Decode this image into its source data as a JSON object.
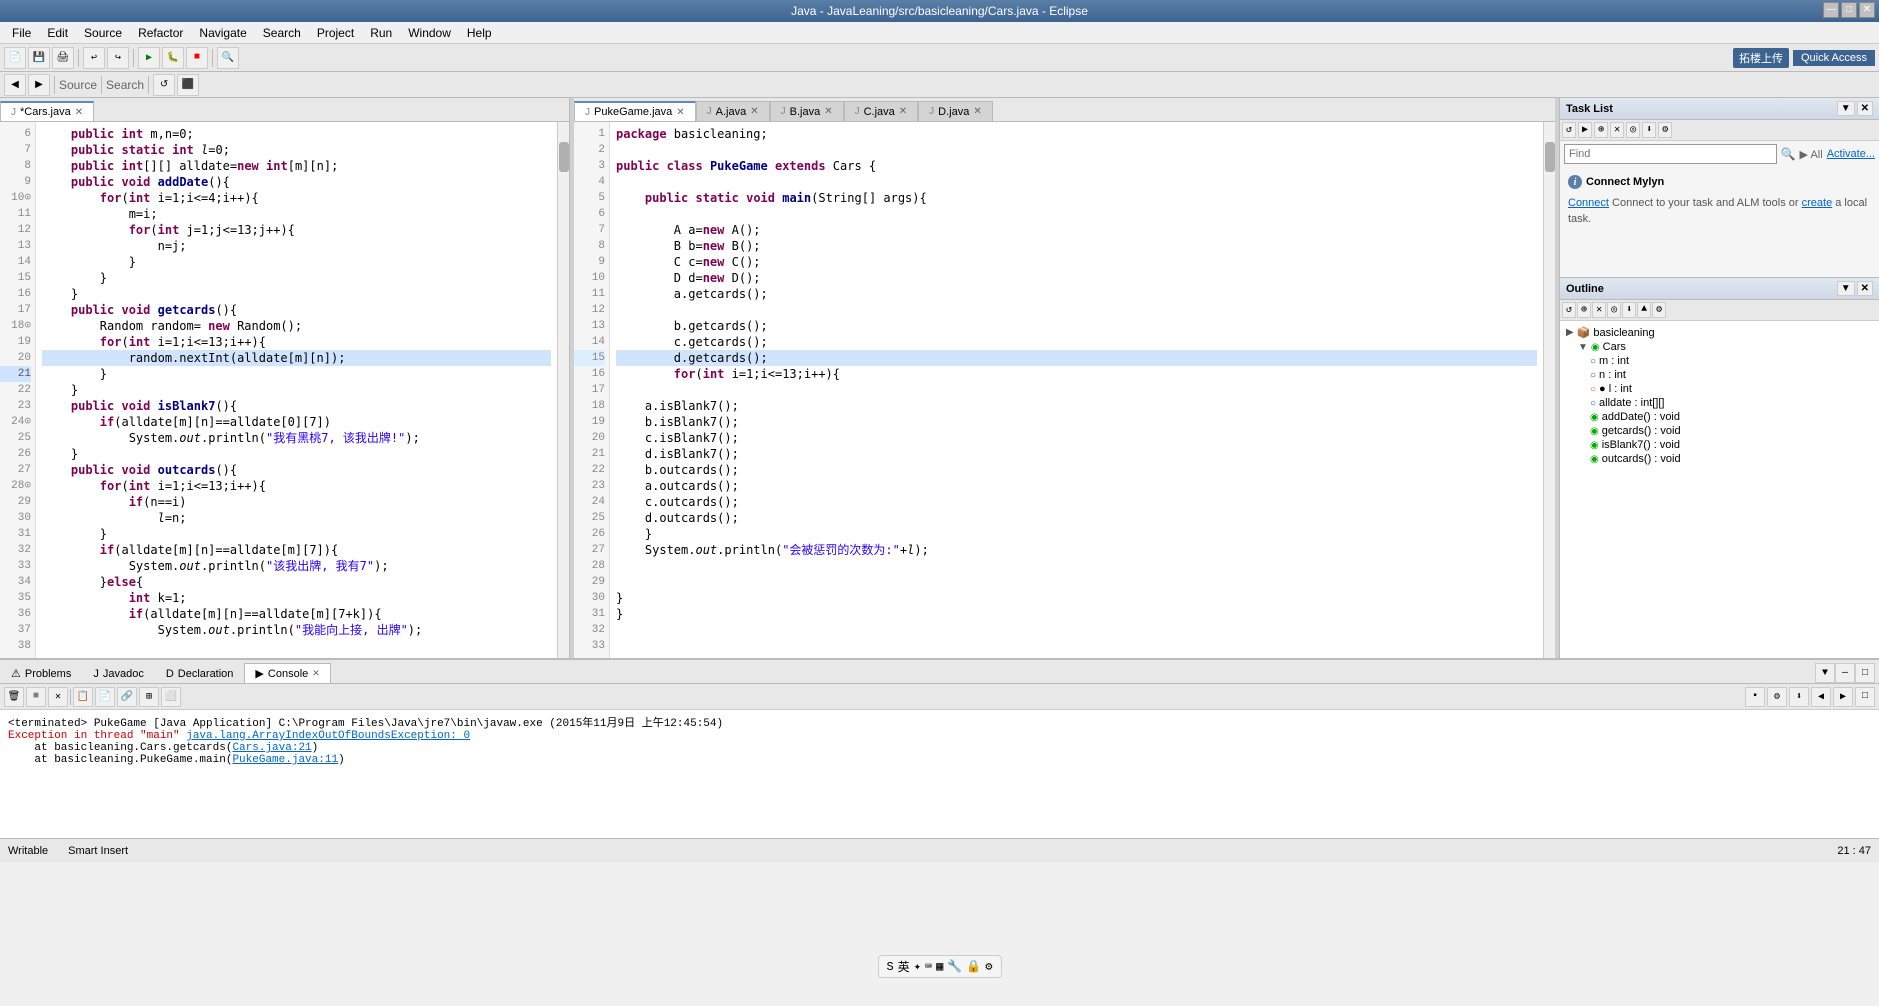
{
  "title_bar": {
    "text": "Java - JavaLeaning/src/basicleaning/Cars.java - Eclipse",
    "minimize": "—",
    "maximize": "□",
    "close": "✕"
  },
  "menu": {
    "items": [
      "File",
      "Edit",
      "Source",
      "Refactor",
      "Navigate",
      "Search",
      "Project",
      "Run",
      "Window",
      "Help"
    ]
  },
  "toolbar2": {
    "source_label": "Source",
    "search_label": "Search"
  },
  "quick_access": {
    "label": "Quick Access"
  },
  "left_editor": {
    "tab_label": "*Cars.java",
    "modified": true,
    "lines": [
      {
        "num": "6",
        "code": ""
      },
      {
        "num": "7",
        "code": "\tpublic int m,n=0;"
      },
      {
        "num": "8",
        "code": "\tpublic static int l=0;"
      },
      {
        "num": "9",
        "code": "\tpublic int[][] alldate=new int[m][n];"
      },
      {
        "num": "10",
        "code": "\tpublic void addDate(){"
      },
      {
        "num": "11",
        "code": "\t\tfor(int i=1;i<=4;i++){"
      },
      {
        "num": "12",
        "code": "\t\t\tm=i;"
      },
      {
        "num": "13",
        "code": "\t\t\tfor(int j=1;j<=13;j++){"
      },
      {
        "num": "14",
        "code": "\t\t\t\tn=j;"
      },
      {
        "num": "15",
        "code": "\t\t\t}"
      },
      {
        "num": "16",
        "code": "\t\t}"
      },
      {
        "num": "17",
        "code": "\t}"
      },
      {
        "num": "18",
        "code": "\tpublic void getcards(){"
      },
      {
        "num": "19",
        "code": "\t\tRandom random= new Random();"
      },
      {
        "num": "20",
        "code": "\t\tfor(int i=1;i<=13;i++){"
      },
      {
        "num": "21",
        "code": "\t\t\trandom.nextInt(alldate[m][n]);",
        "highlight": true
      },
      {
        "num": "22",
        "code": "\t\t}"
      },
      {
        "num": "23",
        "code": "\t}"
      },
      {
        "num": "24",
        "code": "\tpublic void isBlank7(){"
      },
      {
        "num": "25",
        "code": "\t\tif(alldate[m][n]==alldate[0][7])"
      },
      {
        "num": "26",
        "code": "\t\t\tSystem.out.println(\"我有黑桃7, 该我出牌!\");"
      },
      {
        "num": "27",
        "code": "\t}"
      },
      {
        "num": "28",
        "code": "\tpublic void outcards(){"
      },
      {
        "num": "29",
        "code": "\t\tfor(int i=1;i<=13;i++){"
      },
      {
        "num": "30",
        "code": "\t\t\tif(n==i)"
      },
      {
        "num": "31",
        "code": "\t\t\t\tl=n;"
      },
      {
        "num": "32",
        "code": "\t\t}"
      },
      {
        "num": "33",
        "code": "\t\tif(alldate[m][n]==alldate[m][7]){"
      },
      {
        "num": "34",
        "code": "\t\t\tSystem.out.println(\"该我出牌, 我有7\");"
      },
      {
        "num": "35",
        "code": "\t\t}else{"
      },
      {
        "num": "36",
        "code": "\t\t\tint k=1;"
      },
      {
        "num": "37",
        "code": "\t\t\tif(alldate[m][n]==alldate[m][7+k]){"
      },
      {
        "num": "38",
        "code": "\t\t\t\tSystem.out.println(\"我能向上接, 出牌\");"
      }
    ]
  },
  "right_editor": {
    "tabs": [
      {
        "label": "PukeGame.java",
        "active": true,
        "icon": "J"
      },
      {
        "label": "A.java",
        "active": false,
        "icon": "J"
      },
      {
        "label": "B.java",
        "active": false,
        "icon": "J"
      },
      {
        "label": "C.java",
        "active": false,
        "icon": "J"
      },
      {
        "label": "D.java",
        "active": false,
        "icon": "J"
      }
    ],
    "lines": [
      {
        "num": "1",
        "code": "package basicleaning;"
      },
      {
        "num": "2",
        "code": ""
      },
      {
        "num": "3",
        "code": "public class PukeGame extends Cars {"
      },
      {
        "num": "4",
        "code": ""
      },
      {
        "num": "5",
        "code": "\tpublic static void main(String[] args){"
      },
      {
        "num": "6",
        "code": ""
      },
      {
        "num": "7",
        "code": "\t\tA a=new A();"
      },
      {
        "num": "8",
        "code": "\t\tB b=new B();"
      },
      {
        "num": "9",
        "code": "\t\tC c=new C();"
      },
      {
        "num": "10",
        "code": "\t\tD d=new D();"
      },
      {
        "num": "11",
        "code": "\t\ta.getcards();"
      },
      {
        "num": "12",
        "code": ""
      },
      {
        "num": "13",
        "code": "\t\tb.getcards();"
      },
      {
        "num": "14",
        "code": "\t\tc.getcards();"
      },
      {
        "num": "15",
        "code": "\t\td.getcards();"
      },
      {
        "num": "16",
        "code": "\t\tfor(int i=1;i<=13;i++){"
      },
      {
        "num": "17",
        "code": ""
      },
      {
        "num": "18",
        "code": "\ta.isBlank7();"
      },
      {
        "num": "19",
        "code": "\tb.isBlank7();"
      },
      {
        "num": "20",
        "code": "\tc.isBlank7();"
      },
      {
        "num": "21",
        "code": "\td.isBlank7();"
      },
      {
        "num": "22",
        "code": "\tb.outcards();"
      },
      {
        "num": "23",
        "code": "\ta.outcards();"
      },
      {
        "num": "24",
        "code": "\tc.outcards();"
      },
      {
        "num": "25",
        "code": "\td.outcards();"
      },
      {
        "num": "26",
        "code": "\t}"
      },
      {
        "num": "27",
        "code": "\tSystem.out.println(\"会被惩罚的次数为:\"+l);"
      },
      {
        "num": "28",
        "code": ""
      },
      {
        "num": "29",
        "code": ""
      },
      {
        "num": "30",
        "code": ""
      },
      {
        "num": "31",
        "code": ""
      },
      {
        "num": "32",
        "code": "}"
      },
      {
        "num": "33",
        "code": "}"
      }
    ]
  },
  "task_list": {
    "title": "Task List",
    "find_placeholder": "Find",
    "all_label": "All",
    "activate_label": "Activate..."
  },
  "mylyn": {
    "title": "Connect Mylyn",
    "description": "Connect to your task and ALM tools or",
    "connect_label": "Connect",
    "create_label": "create",
    "suffix": "a local task."
  },
  "outline": {
    "title": "Outline",
    "package": "basicleaning",
    "class_name": "Cars",
    "fields": [
      {
        "name": "m : int"
      },
      {
        "name": "n : int"
      },
      {
        "name": "l : int"
      },
      {
        "name": "alldate : int[][]"
      },
      {
        "name": "addDate() : void"
      },
      {
        "name": "getcards() : void"
      },
      {
        "name": "isBlank7() : void"
      },
      {
        "name": "outcards() : void"
      }
    ]
  },
  "bottom_tabs": [
    {
      "label": "Problems",
      "icon": "⚠"
    },
    {
      "label": "Javadoc",
      "icon": "J"
    },
    {
      "label": "Declaration",
      "icon": "D",
      "active": false
    },
    {
      "label": "Console",
      "icon": "▶",
      "active": true
    }
  ],
  "console": {
    "terminated_label": "terminated",
    "app_label": "PukeGame [Java Application]",
    "path": "C:\\Program Files\\Java\\jre7\\bin\\javaw.exe",
    "timestamp": "(2015年11月9日 上午12:45:54)",
    "error_line1": "Exception in thread \"main\" java.lang.ArrayIndexOutOfBoundsException: 0",
    "error_line2": "\tat basicleaning.Cars.getcards(Cars.java:21)",
    "error_line3": "\tat basicleaning.PukeGame.main(PukeGame.java:11)",
    "link1": "Cars.java:21",
    "link2": "PukeGame.java:11"
  },
  "status_bar": {
    "writable": "Writable",
    "insert": "Smart Insert",
    "position": "21 : 47"
  }
}
